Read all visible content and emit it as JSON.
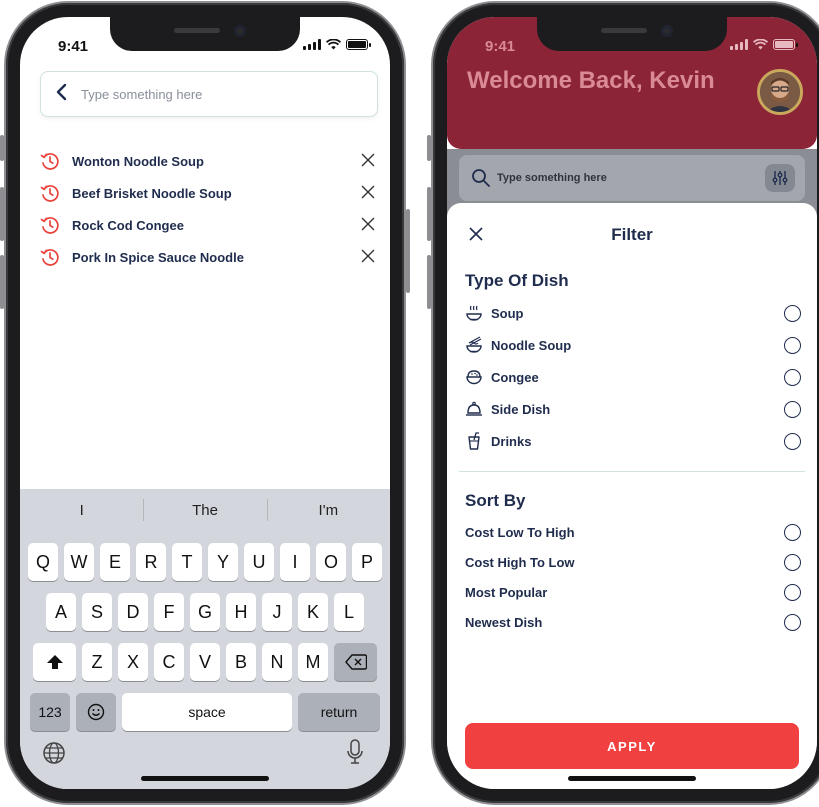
{
  "status": {
    "time": "9:41"
  },
  "left_screen": {
    "search": {
      "placeholder": "Type something here"
    },
    "recent_searches": [
      {
        "label": "Wonton Noodle Soup"
      },
      {
        "label": "Beef Brisket Noodle Soup"
      },
      {
        "label": "Rock Cod Congee"
      },
      {
        "label": "Pork In Spice Sauce Noodle"
      }
    ],
    "keyboard": {
      "suggestions": [
        "I",
        "The",
        "I'm"
      ],
      "row1": [
        "Q",
        "W",
        "E",
        "R",
        "T",
        "Y",
        "U",
        "I",
        "O",
        "P"
      ],
      "row2": [
        "A",
        "S",
        "D",
        "F",
        "G",
        "H",
        "J",
        "K",
        "L"
      ],
      "row3": [
        "Z",
        "X",
        "C",
        "V",
        "B",
        "N",
        "M"
      ],
      "numbers_key": "123",
      "space_key": "space",
      "return_key": "return"
    }
  },
  "right_screen": {
    "greeting": "Welcome Back, Kevin",
    "search": {
      "placeholder": "Type something here"
    },
    "filter": {
      "title": "Filter",
      "type_section": "Type Of Dish",
      "types": [
        {
          "label": "Soup",
          "icon": "soup-bowl-icon"
        },
        {
          "label": "Noodle Soup",
          "icon": "noodle-bowl-icon"
        },
        {
          "label": "Congee",
          "icon": "congee-bowl-icon"
        },
        {
          "label": "Side Dish",
          "icon": "cloche-icon"
        },
        {
          "label": "Drinks",
          "icon": "drink-cup-icon"
        }
      ],
      "sort_section": "Sort By",
      "sort_options": [
        {
          "label": "Cost Low To High"
        },
        {
          "label": "Cost High To Low"
        },
        {
          "label": "Most Popular"
        },
        {
          "label": "Newest Dish"
        }
      ],
      "apply_label": "APPLY"
    }
  },
  "colors": {
    "accent": "#f04040",
    "navy": "#1f2c4d",
    "header_maroon": "#8c2437",
    "history_icon": "#e8423b"
  }
}
